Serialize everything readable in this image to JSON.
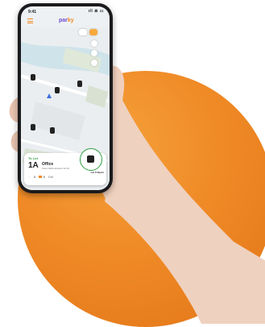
{
  "status_bar": {
    "time": "9:41",
    "signal": "ıll ⋒ ▭"
  },
  "app": {
    "logo_prefix": "par",
    "logo_suffix": "ky"
  },
  "map": {
    "lot_count": 5
  },
  "lot_card": {
    "destination_label": "To Lot",
    "lot_id": "1A",
    "lot_name": "Office",
    "address": "Lake Hallonstrasse 32-34",
    "stat_1": "8",
    "stat_2": "8",
    "stat_3": "Edit",
    "action_label": "Let It Spots"
  },
  "colors": {
    "accent": "#f08a24",
    "brand": "#6b4bd6",
    "available": "#2f9e44",
    "background_circle": "#ef8a26"
  }
}
